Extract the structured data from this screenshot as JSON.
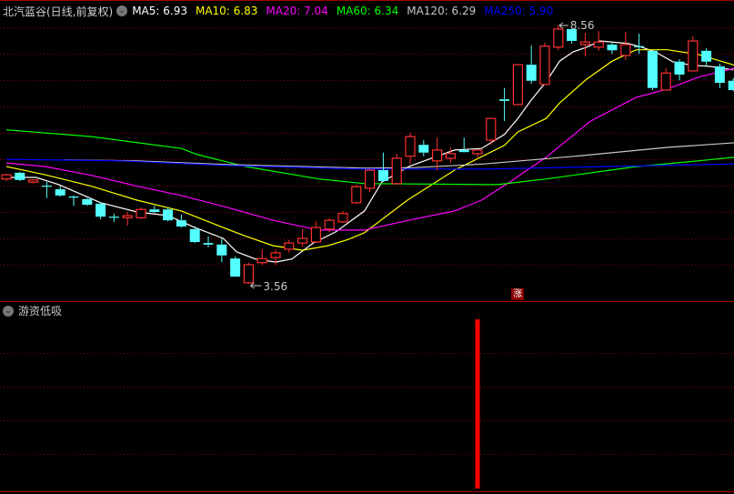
{
  "header": {
    "title": "北汽蓝谷(日线,前复权)",
    "toggle_icon": "chevron-down-circle-icon",
    "ma_items": [
      {
        "label": "MA5: 6.93",
        "color": "#ffffff"
      },
      {
        "label": "MA10: 6.83",
        "color": "#ffff00"
      },
      {
        "label": "MA20: 7.04",
        "color": "#ff00ff"
      },
      {
        "label": "MA60: 6.34",
        "color": "#00ff00"
      },
      {
        "label": "MA120: 6.29",
        "color": "#c8c8c8"
      },
      {
        "label": "MA250: 5.90",
        "color": "#0000ff"
      }
    ]
  },
  "indicator": {
    "title": "游资低吸",
    "toggle_icon": "chevron-down-circle-icon"
  },
  "badge": {
    "label": "涨"
  },
  "chart_data": {
    "type": "candlestick",
    "up_color": "#ff3030",
    "down_color": "#54ffff",
    "price_range": [
      3.56,
      8.56
    ],
    "annotations": [
      {
        "label": "3.56",
        "type": "low",
        "index": 18
      },
      {
        "label": "8.56",
        "type": "high",
        "index": 41
      }
    ],
    "candles": [
      [
        5.59,
        5.69,
        5.55,
        5.67
      ],
      [
        5.71,
        5.73,
        5.55,
        5.57
      ],
      [
        5.53,
        5.58,
        5.5,
        5.57
      ],
      [
        5.46,
        5.53,
        5.22,
        5.44
      ],
      [
        5.39,
        5.46,
        5.25,
        5.27
      ],
      [
        5.25,
        5.27,
        5.07,
        5.23
      ],
      [
        5.2,
        5.22,
        5.07,
        5.09
      ],
      [
        5.11,
        5.14,
        4.81,
        4.86
      ],
      [
        4.86,
        4.92,
        4.76,
        4.84
      ],
      [
        4.84,
        4.95,
        4.69,
        4.88
      ],
      [
        4.84,
        5.04,
        4.81,
        5.0
      ],
      [
        5.0,
        5.07,
        4.93,
        4.95
      ],
      [
        5.0,
        5.04,
        4.77,
        4.79
      ],
      [
        4.79,
        4.9,
        4.65,
        4.67
      ],
      [
        4.62,
        4.67,
        4.35,
        4.37
      ],
      [
        4.35,
        4.48,
        4.27,
        4.32
      ],
      [
        4.32,
        4.44,
        3.98,
        4.11
      ],
      [
        4.05,
        4.09,
        3.7,
        3.7
      ],
      [
        3.58,
        3.97,
        3.56,
        3.93
      ],
      [
        3.97,
        4.23,
        3.93,
        4.05
      ],
      [
        4.07,
        4.23,
        3.93,
        4.16
      ],
      [
        4.23,
        4.41,
        4.16,
        4.35
      ],
      [
        4.35,
        4.62,
        4.28,
        4.44
      ],
      [
        4.37,
        4.77,
        4.35,
        4.65
      ],
      [
        4.62,
        4.83,
        4.56,
        4.79
      ],
      [
        4.76,
        4.97,
        4.74,
        4.92
      ],
      [
        5.13,
        5.48,
        5.11,
        5.44
      ],
      [
        5.41,
        5.78,
        5.34,
        5.76
      ],
      [
        5.76,
        6.1,
        5.53,
        5.55
      ],
      [
        5.5,
        6.08,
        5.48,
        5.99
      ],
      [
        6.03,
        6.48,
        5.87,
        6.41
      ],
      [
        6.25,
        6.34,
        6.03,
        6.1
      ],
      [
        5.94,
        6.39,
        5.76,
        6.15
      ],
      [
        5.99,
        6.2,
        5.9,
        6.08
      ],
      [
        6.15,
        6.39,
        6.1,
        6.11
      ],
      [
        6.08,
        6.15,
        6.01,
        6.15
      ],
      [
        6.34,
        6.76,
        6.25,
        6.76
      ],
      [
        7.13,
        7.35,
        6.71,
        7.1
      ],
      [
        7.03,
        7.8,
        7.03,
        7.8
      ],
      [
        7.8,
        8.17,
        7.43,
        7.49
      ],
      [
        7.42,
        8.23,
        7.42,
        8.16
      ],
      [
        8.14,
        8.56,
        8.08,
        8.49
      ],
      [
        8.49,
        8.49,
        8.21,
        8.26
      ],
      [
        8.19,
        8.42,
        7.96,
        8.24
      ],
      [
        8.14,
        8.45,
        8.07,
        8.24
      ],
      [
        8.19,
        8.24,
        8.01,
        8.08
      ],
      [
        7.98,
        8.44,
        7.89,
        8.19
      ],
      [
        8.16,
        8.4,
        8.01,
        8.14
      ],
      [
        8.07,
        8.07,
        7.31,
        7.35
      ],
      [
        7.31,
        7.73,
        7.31,
        7.64
      ],
      [
        7.86,
        7.91,
        7.5,
        7.61
      ],
      [
        7.68,
        8.35,
        7.68,
        8.26
      ],
      [
        8.07,
        8.12,
        7.79,
        7.86
      ],
      [
        7.77,
        7.82,
        7.35,
        7.45
      ],
      [
        7.49,
        7.54,
        7.29,
        7.31
      ]
    ],
    "candle_fields": [
      "open",
      "high",
      "low",
      "close"
    ],
    "ma_series": [
      {
        "name": "MA5",
        "color": "#ffffff",
        "points": [
          [
            0,
            5.62
          ],
          [
            2.2,
            5.62
          ],
          [
            3.9,
            5.48
          ],
          [
            7,
            5.13
          ],
          [
            9.7,
            4.95
          ],
          [
            12,
            4.88
          ],
          [
            14,
            4.65
          ],
          [
            16.1,
            4.44
          ],
          [
            17.1,
            4.18
          ],
          [
            18.5,
            4.04
          ],
          [
            20,
            3.98
          ],
          [
            21.2,
            4.04
          ],
          [
            22.8,
            4.35
          ],
          [
            24.5,
            4.57
          ],
          [
            26.6,
            4.97
          ],
          [
            27.9,
            5.53
          ],
          [
            29.9,
            5.83
          ],
          [
            32,
            6.03
          ],
          [
            33.3,
            6.15
          ],
          [
            35.3,
            6.18
          ],
          [
            37,
            6.45
          ],
          [
            38,
            6.76
          ],
          [
            39,
            7.12
          ],
          [
            40.1,
            7.47
          ],
          [
            41.1,
            7.87
          ],
          [
            42.1,
            8.05
          ],
          [
            43.1,
            8.14
          ],
          [
            44.1,
            8.26
          ],
          [
            46.2,
            8.21
          ],
          [
            47.2,
            8.14
          ],
          [
            48.2,
            8.05
          ],
          [
            49.5,
            7.86
          ],
          [
            50.9,
            7.79
          ],
          [
            52.2,
            7.77
          ],
          [
            54,
            7.7
          ]
        ]
      },
      {
        "name": "MA10",
        "color": "#ffff00",
        "points": [
          [
            0,
            5.83
          ],
          [
            2.9,
            5.67
          ],
          [
            6.3,
            5.45
          ],
          [
            9.7,
            5.18
          ],
          [
            13,
            4.97
          ],
          [
            16.1,
            4.65
          ],
          [
            17.8,
            4.48
          ],
          [
            19.8,
            4.3
          ],
          [
            22,
            4.21
          ],
          [
            23.9,
            4.3
          ],
          [
            25.4,
            4.42
          ],
          [
            26.6,
            4.55
          ],
          [
            29.8,
            5.18
          ],
          [
            33.3,
            5.76
          ],
          [
            37,
            6.24
          ],
          [
            38,
            6.5
          ],
          [
            40.1,
            6.76
          ],
          [
            41.1,
            7.06
          ],
          [
            43.1,
            7.52
          ],
          [
            45,
            7.87
          ],
          [
            46.8,
            8.09
          ],
          [
            49.1,
            8.09
          ],
          [
            51.4,
            8.0
          ],
          [
            54.1,
            7.79
          ]
        ]
      },
      {
        "name": "MA20",
        "color": "#ff00ff",
        "points": [
          [
            0,
            5.9
          ],
          [
            2.9,
            5.83
          ],
          [
            6.3,
            5.66
          ],
          [
            9.7,
            5.45
          ],
          [
            13,
            5.27
          ],
          [
            16.4,
            5.04
          ],
          [
            19.8,
            4.79
          ],
          [
            23.2,
            4.6
          ],
          [
            26.6,
            4.6
          ],
          [
            29.9,
            4.79
          ],
          [
            33.3,
            4.97
          ],
          [
            35.3,
            5.18
          ],
          [
            37.4,
            5.53
          ],
          [
            40.1,
            6.01
          ],
          [
            43.4,
            6.71
          ],
          [
            46.8,
            7.17
          ],
          [
            49.1,
            7.33
          ],
          [
            51.4,
            7.56
          ],
          [
            54.1,
            7.73
          ]
        ]
      },
      {
        "name": "MA60",
        "color": "#00ff00",
        "points": [
          [
            0,
            6.54
          ],
          [
            6.3,
            6.41
          ],
          [
            13,
            6.18
          ],
          [
            14.2,
            6.06
          ],
          [
            17.8,
            5.83
          ],
          [
            23.2,
            5.59
          ],
          [
            26.6,
            5.5
          ],
          [
            36.5,
            5.48
          ],
          [
            40.1,
            5.59
          ],
          [
            46.8,
            5.83
          ],
          [
            51.4,
            5.94
          ],
          [
            54.1,
            6.01
          ]
        ]
      },
      {
        "name": "MA120",
        "color": "#c8c8c8",
        "points": [
          [
            4.3,
            5.96
          ],
          [
            9.7,
            5.94
          ],
          [
            16.4,
            5.87
          ],
          [
            26.6,
            5.8
          ],
          [
            30.4,
            5.81
          ],
          [
            35.5,
            5.88
          ],
          [
            42.3,
            6.03
          ],
          [
            49.1,
            6.2
          ],
          [
            54.1,
            6.29
          ]
        ]
      },
      {
        "name": "MA250",
        "color": "#0000ff",
        "points": [
          [
            0,
            5.97
          ],
          [
            8.5,
            5.94
          ],
          [
            16.4,
            5.85
          ],
          [
            26.6,
            5.78
          ],
          [
            35.5,
            5.78
          ],
          [
            44.6,
            5.83
          ],
          [
            54.1,
            5.88
          ]
        ]
      }
    ],
    "indicator_signals": [
      {
        "index": 35,
        "value": 1,
        "color": "#ff0000"
      }
    ]
  }
}
